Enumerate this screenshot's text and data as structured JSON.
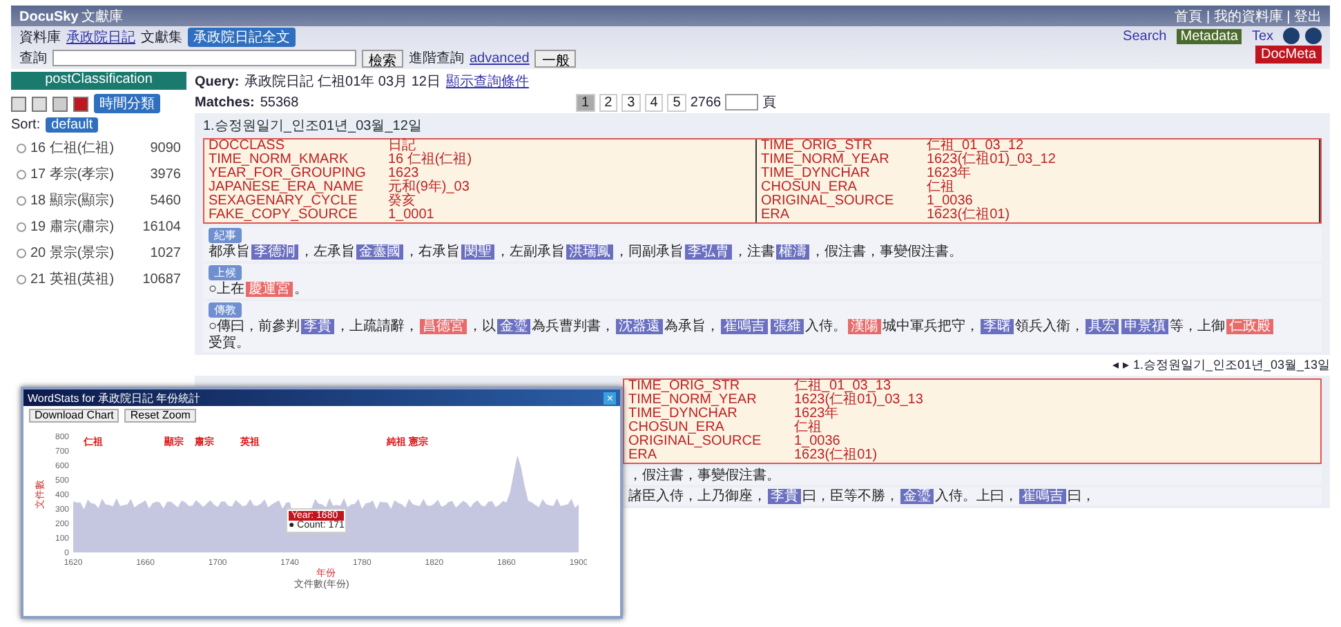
{
  "header": {
    "logo": "DocuSky",
    "subtitle": "文獻庫",
    "links": "首頁 | 我的資料庫 | 登出"
  },
  "toolbar": {
    "db_label": "資料庫",
    "db_name": "承政院日記",
    "corpus_label": "文獻集",
    "corpus_select": "承政院日記全文",
    "query_label": "查詢",
    "search_button": "檢索",
    "post_label": "進階查詢",
    "advanced_link": "advanced",
    "mode_select": "一般"
  },
  "right_tools": {
    "links": [
      {
        "label": "Search",
        "selected": false
      },
      {
        "label": "Metadata",
        "selected": true
      },
      {
        "label": "Tex",
        "selected": false
      }
    ],
    "doc_button": "DocMeta"
  },
  "sidebar": {
    "title": "postClassification",
    "select": "時間分類",
    "sort_label": "Sort:",
    "sort_select": "default",
    "items": [
      {
        "label": "16 仁祖(仁祖)",
        "count": "9090",
        "selected": false
      },
      {
        "label": "17 孝宗(孝宗)",
        "count": "3976",
        "selected": false
      },
      {
        "label": "18 顯宗(顯宗)",
        "count": "5460",
        "selected": false
      },
      {
        "label": "19 肅宗(肅宗)",
        "count": "16104",
        "selected": false
      },
      {
        "label": "20 景宗(景宗)",
        "count": "1027",
        "selected": false
      },
      {
        "label": "21 英祖(英祖)",
        "count": "10687",
        "selected": false
      }
    ]
  },
  "query": {
    "label": "Query:",
    "text": "承政院日記 仁祖01年 03月 12日",
    "link": "顯示查詢條件"
  },
  "matches": {
    "label": "Matches:",
    "count": "55368"
  },
  "pagination": {
    "pages": [
      {
        "label": "1",
        "selected": true
      },
      {
        "label": "2",
        "selected": false
      },
      {
        "label": "3",
        "selected": false
      },
      {
        "label": "4",
        "selected": false
      },
      {
        "label": "5",
        "selected": false
      }
    ],
    "total": "2766",
    "go_label": "頁"
  },
  "record": {
    "title": "1.승정원일기_인조01년_03월_12일",
    "metadata": [
      {
        "key": "DOCCLASS",
        "value": "日記"
      },
      {
        "key": "TIME_ORIG_STR",
        "value": "仁祖_01_03_12"
      },
      {
        "key": "TIME_NORM_KMARK",
        "value": "16 仁祖(仁祖)"
      },
      {
        "key": "TIME_NORM_YEAR",
        "value": "1623(仁祖01)_03_12"
      },
      {
        "key": "YEAR_FOR_GROUPING",
        "value": "1623"
      },
      {
        "key": "TIME_DYNCHAR",
        "value": "1623年"
      },
      {
        "key": "JAPANESE_ERA_NAME",
        "value": "元和(9年)_03"
      },
      {
        "key": "CHOSUN_ERA",
        "value": "仁祖"
      },
      {
        "key": "SEXAGENARY_CYCLE",
        "value": "癸亥"
      },
      {
        "key": "ORIGINAL_SOURCE",
        "value": "1_0036"
      },
      {
        "key": "FAKE_COPY_SOURCE",
        "value": "1_0001"
      },
      {
        "key": "ERA",
        "value": "1623(仁祖01)"
      }
    ],
    "sections": [
      {
        "label": "紀事",
        "segments": [
          {
            "text": "都承旨",
            "kind": "text"
          },
          {
            "text": "李德泂",
            "kind": "person"
          },
          {
            "text": "，左承旨",
            "kind": "text"
          },
          {
            "text": "金藎國",
            "kind": "person"
          },
          {
            "text": "，右承旨",
            "kind": "text"
          },
          {
            "text": "閔聖",
            "kind": "person"
          },
          {
            "text": "，左副承旨",
            "kind": "text"
          },
          {
            "text": "洪瑞鳳",
            "kind": "person"
          },
          {
            "text": "，同副承旨",
            "kind": "text"
          },
          {
            "text": "李弘胄",
            "kind": "person"
          },
          {
            "text": "，注書",
            "kind": "text"
          },
          {
            "text": "權濤",
            "kind": "person"
          },
          {
            "text": "，假注書，事變假注書。",
            "kind": "text"
          }
        ]
      },
      {
        "label": "上候",
        "segments": [
          {
            "text": "○上在",
            "kind": "text"
          },
          {
            "text": "慶運宮",
            "kind": "place"
          },
          {
            "text": "。",
            "kind": "text"
          }
        ]
      },
      {
        "label": "傳教",
        "segments": [
          {
            "text": "○傳曰，前參判",
            "kind": "text"
          },
          {
            "text": "李貴",
            "kind": "person"
          },
          {
            "text": "，上疏請辭，",
            "kind": "text"
          },
          {
            "text": "昌德宮",
            "kind": "place"
          },
          {
            "text": "，以",
            "kind": "text"
          },
          {
            "text": "金瑬",
            "kind": "person"
          },
          {
            "text": "為兵曹判書，",
            "kind": "text"
          },
          {
            "text": "沈器遠",
            "kind": "person"
          },
          {
            "text": "為承旨，",
            "kind": "text"
          },
          {
            "text": "崔鳴吉",
            "kind": "person"
          },
          {
            "text": "張維",
            "kind": "person"
          },
          {
            "text": "入侍。",
            "kind": "text"
          },
          {
            "text": "漢陽",
            "kind": "place"
          },
          {
            "text": "城中軍兵把守，",
            "kind": "text"
          },
          {
            "text": "李曙",
            "kind": "person"
          },
          {
            "text": "領兵入衛，",
            "kind": "text"
          },
          {
            "text": "具宏",
            "kind": "person"
          },
          {
            "text": "申景禛",
            "kind": "person"
          },
          {
            "text": "等，上御",
            "kind": "text"
          },
          {
            "text": "仁政殿",
            "kind": "place"
          },
          {
            "text": "受賀。",
            "kind": "text"
          }
        ]
      }
    ]
  },
  "next_link": "◂ ▸ 1.승정원일기_인조01년_03월_13일",
  "record2": {
    "metadata": [
      {
        "key": "TIME_ORIG_STR",
        "value": "仁祖_01_03_13"
      },
      {
        "key": "TIME_NORM_YEAR",
        "value": "1623(仁祖01)_03_13"
      },
      {
        "key": "TIME_DYNCHAR",
        "value": "1623年"
      },
      {
        "key": "CHOSUN_ERA",
        "value": "仁祖"
      },
      {
        "key": "ORIGINAL_SOURCE",
        "value": "1_0036"
      },
      {
        "key": "ERA",
        "value": "1623(仁祖01)"
      }
    ],
    "sections": [
      {
        "segments": [
          {
            "text": "，假注書，事變假注書。",
            "kind": "text"
          }
        ]
      },
      {
        "segments": [
          {
            "text": "諸臣入侍，上乃御座，",
            "kind": "text"
          },
          {
            "text": "李貴",
            "kind": "person"
          },
          {
            "text": "曰，臣等不勝，",
            "kind": "text"
          },
          {
            "text": "金瑬",
            "kind": "person"
          },
          {
            "text": "入侍。上曰，",
            "kind": "text"
          },
          {
            "text": "崔鳴吉",
            "kind": "person"
          },
          {
            "text": "曰，",
            "kind": "text"
          }
        ]
      }
    ]
  },
  "popup": {
    "title": "WordStats for 承政院日記 年份統計",
    "buttons": [
      "Download Chart",
      "Reset Zoom"
    ],
    "close": "×",
    "y_axis_label": "文件數",
    "x_axis_label": "年份",
    "y_ticks": [
      "800",
      "700",
      "600",
      "500",
      "400",
      "300",
      "200",
      "100",
      "0"
    ],
    "x_ticks": [
      "1620",
      "1660",
      "1700",
      "1740",
      "1780",
      "1820",
      "1860",
      "1900"
    ],
    "markers": [
      {
        "label": "仁祖"
      },
      {
        "label": "顯宗"
      },
      {
        "label": "肅宗"
      },
      {
        "label": "英祖"
      },
      {
        "label": "純祖 憲宗"
      }
    ],
    "tooltip": {
      "title": "Year: 1680",
      "value": "● Count: 171"
    },
    "legend": "文件數(年份)"
  }
}
